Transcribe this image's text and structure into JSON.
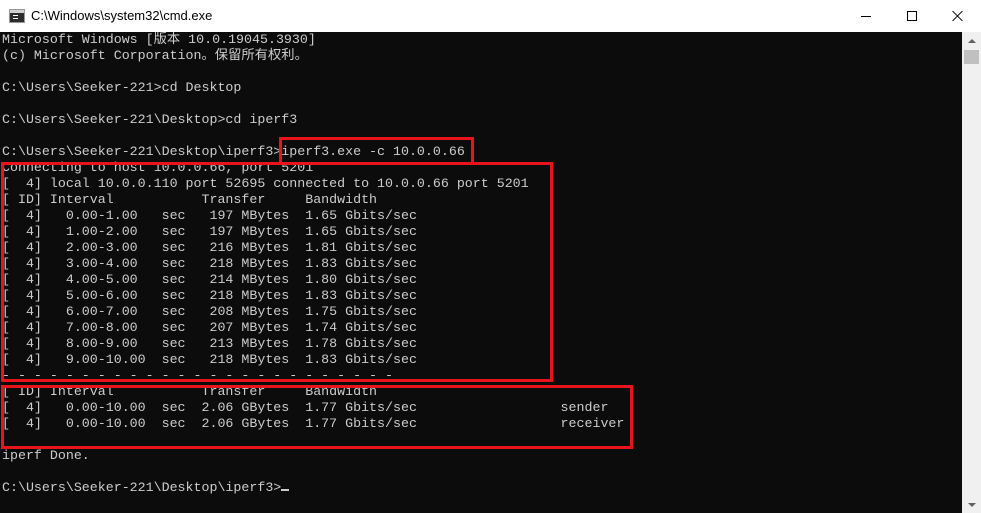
{
  "window": {
    "title": "C:\\Windows\\system32\\cmd.exe",
    "icons": {
      "app": "cmd-console-icon",
      "minimize": "minimize-icon",
      "maximize": "maximize-icon",
      "close": "close-icon"
    }
  },
  "console": {
    "lines": [
      "Microsoft Windows [版本 10.0.19045.3930]",
      "(c) Microsoft Corporation。保留所有权利。",
      "",
      "C:\\Users\\Seeker-221>cd Desktop",
      "",
      "C:\\Users\\Seeker-221\\Desktop>cd iperf3",
      "",
      "C:\\Users\\Seeker-221\\Desktop\\iperf3>iperf3.exe -c 10.0.0.66",
      "Connecting to host 10.0.0.66, port 5201",
      "[  4] local 10.0.0.110 port 52695 connected to 10.0.0.66 port 5201",
      "[ ID] Interval           Transfer     Bandwidth",
      "[  4]   0.00-1.00   sec   197 MBytes  1.65 Gbits/sec",
      "[  4]   1.00-2.00   sec   197 MBytes  1.65 Gbits/sec",
      "[  4]   2.00-3.00   sec   216 MBytes  1.81 Gbits/sec",
      "[  4]   3.00-4.00   sec   218 MBytes  1.83 Gbits/sec",
      "[  4]   4.00-5.00   sec   214 MBytes  1.80 Gbits/sec",
      "[  4]   5.00-6.00   sec   218 MBytes  1.83 Gbits/sec",
      "[  4]   6.00-7.00   sec   208 MBytes  1.75 Gbits/sec",
      "[  4]   7.00-8.00   sec   207 MBytes  1.74 Gbits/sec",
      "[  4]   8.00-9.00   sec   213 MBytes  1.78 Gbits/sec",
      "[  4]   9.00-10.00  sec   218 MBytes  1.83 Gbits/sec",
      "- - - - - - - - - - - - - - - - - - - - - - - - -",
      "[ ID] Interval           Transfer     Bandwidth",
      "[  4]   0.00-10.00  sec  2.06 GBytes  1.77 Gbits/sec                  sender",
      "[  4]   0.00-10.00  sec  2.06 GBytes  1.77 Gbits/sec                  receiver",
      "",
      "iperf Done.",
      "",
      "C:\\Users\\Seeker-221\\Desktop\\iperf3>"
    ]
  },
  "colors": {
    "console_background": "#0c0c0c",
    "console_text": "#cccccc",
    "highlight_box": "#e8141b"
  }
}
